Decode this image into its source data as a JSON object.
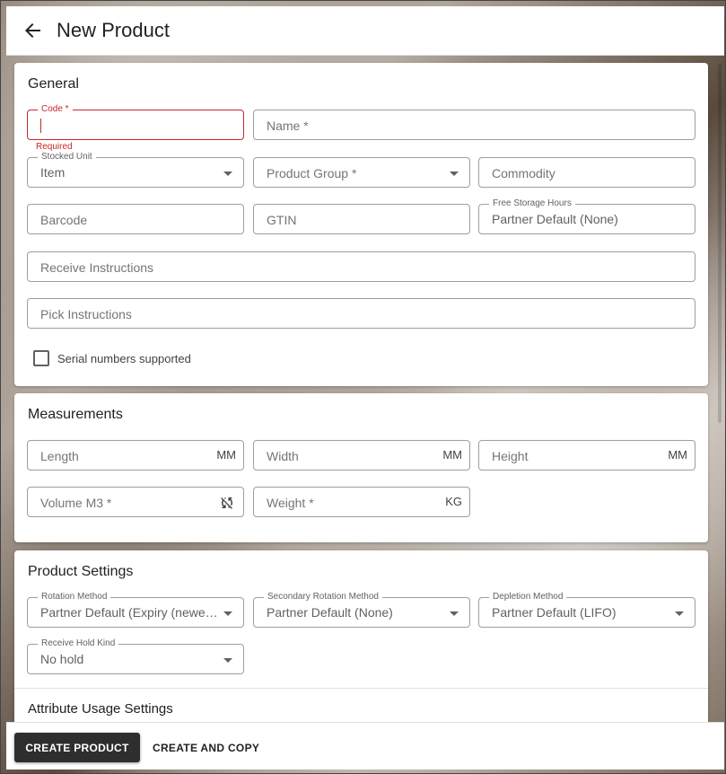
{
  "header": {
    "title": "New Product"
  },
  "general": {
    "title": "General",
    "code": {
      "label": "Code *",
      "error": "Required"
    },
    "name": {
      "placeholder": "Name *"
    },
    "stocked_unit": {
      "label": "Stocked Unit",
      "value": "Item"
    },
    "product_group": {
      "placeholder": "Product Group *"
    },
    "commodity": {
      "placeholder": "Commodity"
    },
    "barcode": {
      "placeholder": "Barcode"
    },
    "gtin": {
      "placeholder": "GTIN"
    },
    "free_storage_hours": {
      "label": "Free Storage Hours",
      "value": "Partner Default (None)"
    },
    "receive_instructions": {
      "placeholder": "Receive Instructions"
    },
    "pick_instructions": {
      "placeholder": "Pick Instructions"
    },
    "serial_numbers": {
      "label": "Serial numbers supported",
      "checked": false
    }
  },
  "measurements": {
    "title": "Measurements",
    "length": {
      "placeholder": "Length",
      "unit": "MM"
    },
    "width": {
      "placeholder": "Width",
      "unit": "MM"
    },
    "height": {
      "placeholder": "Height",
      "unit": "MM"
    },
    "volume": {
      "placeholder": "Volume M3 *",
      "icon": "sync-off-icon"
    },
    "weight": {
      "placeholder": "Weight *",
      "unit": "KG"
    }
  },
  "product_settings": {
    "title": "Product Settings",
    "rotation_method": {
      "label": "Rotation Method",
      "value": "Partner Default (Expiry (newest first))"
    },
    "secondary_rotation_method": {
      "label": "Secondary Rotation Method",
      "value": "Partner Default (None)"
    },
    "depletion_method": {
      "label": "Depletion Method",
      "value": "Partner Default (LIFO)"
    },
    "receive_hold_kind": {
      "label": "Receive Hold Kind",
      "value": "No hold"
    }
  },
  "attribute_usage": {
    "title": "Attribute Usage Settings"
  },
  "footer": {
    "create_product_label": "CREATE PRODUCT",
    "create_and_copy_label": "CREATE AND COPY"
  }
}
